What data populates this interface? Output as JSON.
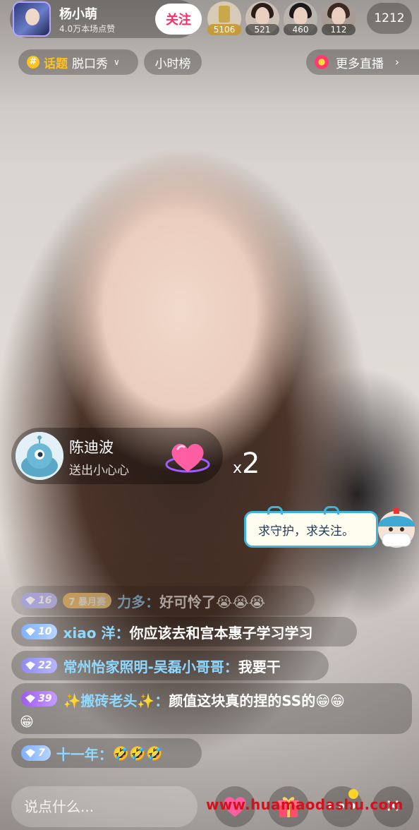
{
  "header": {
    "host_name": "杨小萌",
    "host_likes": "4.0万本场点赞",
    "follow_label": "关注",
    "viewers": [
      {
        "name": "viewer-1",
        "count": "5106",
        "gold": true
      },
      {
        "name": "viewer-2",
        "count": "521",
        "gold": false
      },
      {
        "name": "viewer-3",
        "count": "460",
        "gold": false
      },
      {
        "name": "viewer-4",
        "count": "112",
        "gold": false
      }
    ],
    "online_count": "1212"
  },
  "subbar": {
    "topic_label": "话题",
    "topic_name": "脱口秀",
    "hour_rank": "小时榜",
    "more_live": "更多直播"
  },
  "gift": {
    "user": "陈迪波",
    "action": "送出小心心",
    "count_prefix": "x",
    "count": "2"
  },
  "guard_sticker": "求守护，求关注。",
  "chat": [
    {
      "level": "16",
      "month_badge": "7 暴月赛",
      "name": "力多",
      "text": "好可怜了😭😭😭"
    },
    {
      "level": "10",
      "name": "xiao 洋",
      "text": "你应该去和宫本惠子学习学习"
    },
    {
      "level": "22",
      "name": "常州怡家照明-吴磊小哥哥",
      "text": "我要干"
    },
    {
      "level": "39",
      "name": "✨搬砖老头✨",
      "text": "颜值这块真的捏的SS的😁😁",
      "text2": "😁"
    },
    {
      "level": "7",
      "name": "十一年",
      "text": "🤣🤣🤣"
    }
  ],
  "input": {
    "placeholder": "说点什么..."
  },
  "watermark": "www.huamaodashu.com",
  "colors": {
    "follow_text": "#ff2d6a",
    "topic_accent": "#ffc21a",
    "chat_name": "#8fd8ff",
    "watermark": "#d4121e"
  }
}
